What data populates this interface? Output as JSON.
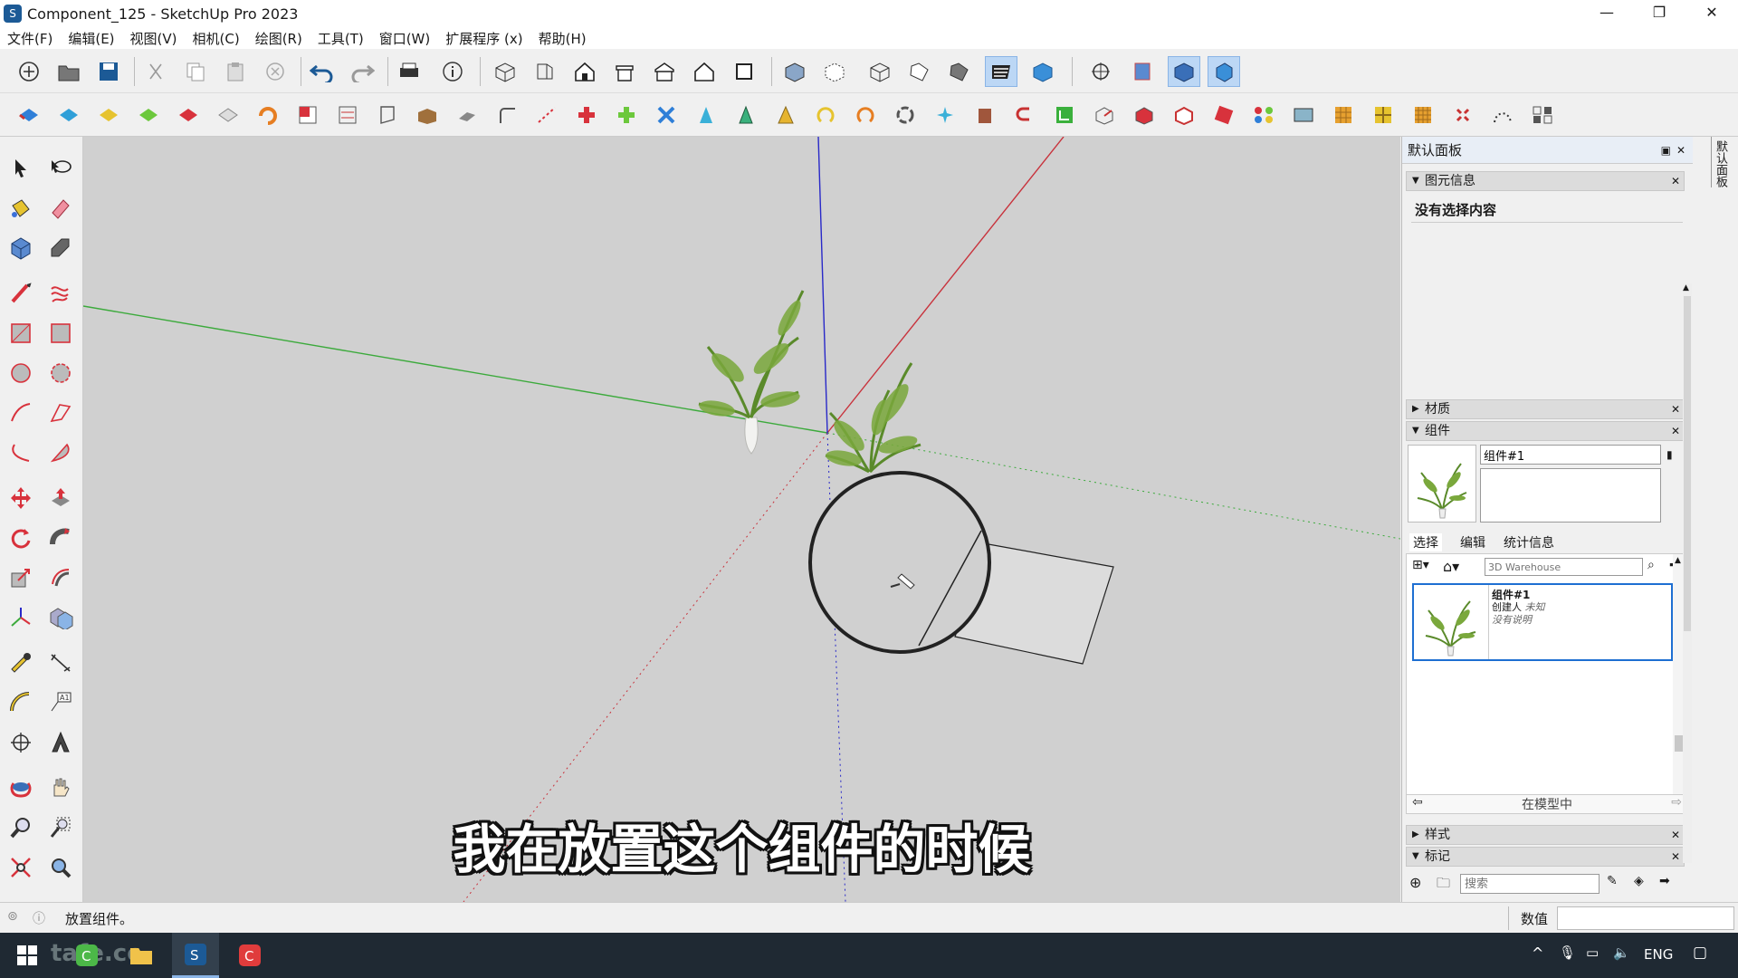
{
  "window": {
    "title": "Component_125 - SketchUp Pro 2023",
    "app_icon": "sketchup-icon",
    "minimize": "—",
    "maximize": "❐",
    "close": "✕"
  },
  "menu": [
    "文件(F)",
    "编辑(E)",
    "视图(V)",
    "相机(C)",
    "绘图(R)",
    "工具(T)",
    "窗口(W)",
    "扩展程序 (x)",
    "帮助(H)"
  ],
  "subtitle": "我在放置这个组件的时候",
  "panel": {
    "title": "默认面板",
    "entity_info": {
      "header": "图元信息",
      "text": "没有选择内容"
    },
    "materials": {
      "header": "材质"
    },
    "components": {
      "header": "组件",
      "name_value": "组件#1",
      "tabs": [
        "选择",
        "编辑",
        "统计信息"
      ],
      "search_placeholder": "3D Warehouse",
      "item": {
        "name": "组件#1",
        "author": "创建人",
        "author_value": "未知",
        "desc": "没有说明"
      },
      "footer": "在模型中"
    },
    "styles": {
      "header": "样式"
    },
    "tags": {
      "header": "标记",
      "search_placeholder": "搜索"
    }
  },
  "side_tab": "默认面板",
  "status": {
    "text": "放置组件。",
    "measure_label": "数值",
    "measure_value": ""
  },
  "taskbar": {
    "lang": "ENG",
    "watermark": "tafe.cc"
  },
  "colors": {
    "viewport": "#d0d0d0",
    "axis_red": "#c8323c",
    "axis_green": "#3caa3c",
    "axis_blue": "#2828c8",
    "selection": "#1e6fd2"
  }
}
